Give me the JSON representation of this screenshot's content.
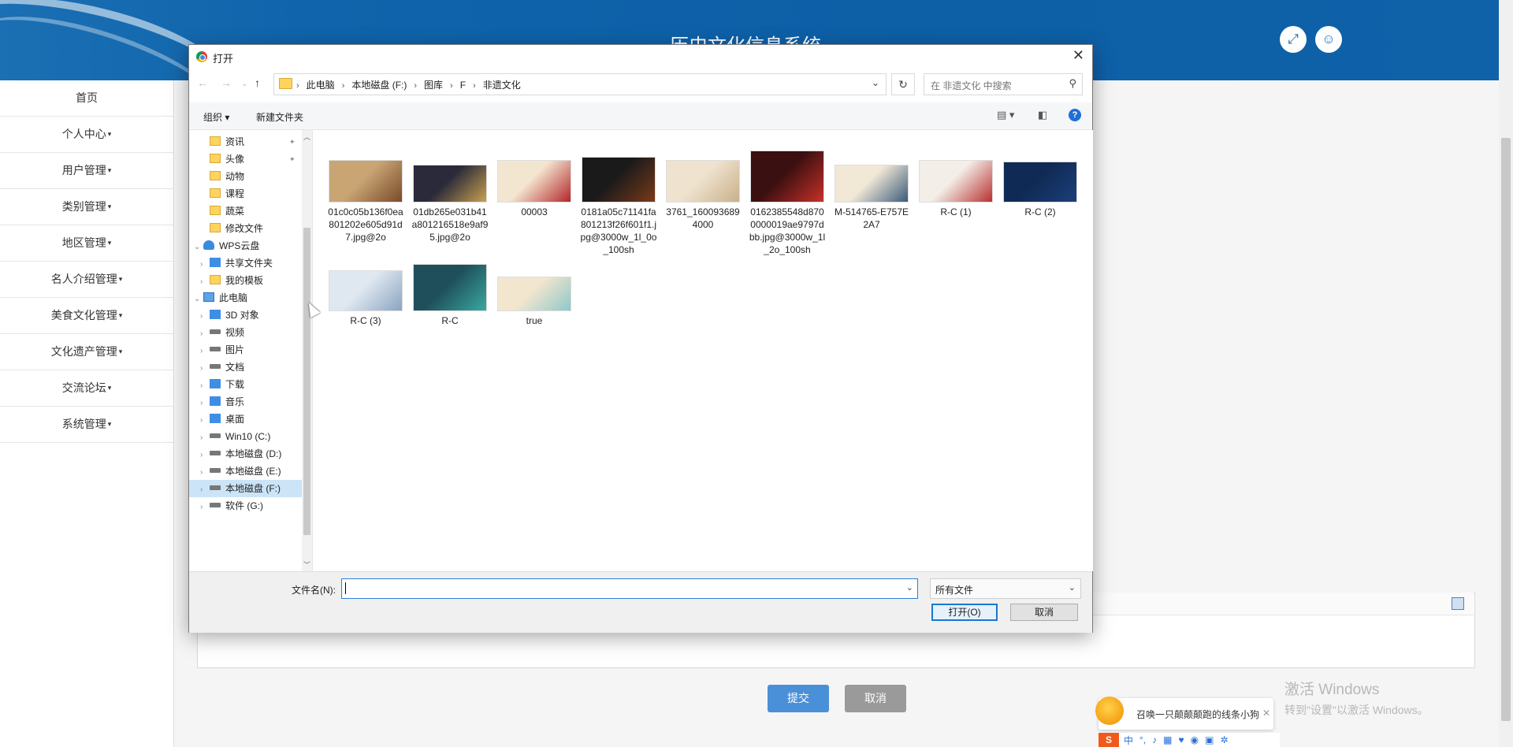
{
  "app": {
    "title": "历史文化信息系统",
    "sidebar": [
      "首页",
      "个人中心",
      "用户管理",
      "类别管理",
      "地区管理",
      "名人介绍管理",
      "美食文化管理",
      "文化遗产管理",
      "交流论坛",
      "系统管理"
    ],
    "submit_label": "提交",
    "cancel_label": "取消"
  },
  "dialog": {
    "title": "打开",
    "breadcrumb": [
      "此电脑",
      "本地磁盘 (F:)",
      "图库",
      "F",
      "非遗文化"
    ],
    "search_placeholder": "在 非遗文化 中搜索",
    "toolbar": {
      "organize": "组织 ▾",
      "new_folder": "新建文件夹"
    },
    "tree": [
      {
        "label": "资讯",
        "icon": "folder",
        "level": 1,
        "pinned": true
      },
      {
        "label": "头像",
        "icon": "folder",
        "level": 1,
        "pinned": true
      },
      {
        "label": "动物",
        "icon": "folder",
        "level": 1
      },
      {
        "label": "课程",
        "icon": "folder",
        "level": 1
      },
      {
        "label": "蔬菜",
        "icon": "folder",
        "level": 1
      },
      {
        "label": "修改文件",
        "icon": "folder",
        "level": 1
      },
      {
        "label": "WPS云盘",
        "icon": "cloud",
        "level": 0,
        "expanded": true
      },
      {
        "label": "共享文件夹",
        "icon": "blue",
        "level": 1
      },
      {
        "label": "我的模板",
        "icon": "folder",
        "level": 1
      },
      {
        "label": "此电脑",
        "icon": "pc",
        "level": 0,
        "expanded": true
      },
      {
        "label": "3D 对象",
        "icon": "blue",
        "level": 1
      },
      {
        "label": "视频",
        "icon": "drive",
        "level": 1
      },
      {
        "label": "图片",
        "icon": "drive",
        "level": 1
      },
      {
        "label": "文档",
        "icon": "drive",
        "level": 1
      },
      {
        "label": "下载",
        "icon": "blue",
        "level": 1
      },
      {
        "label": "音乐",
        "icon": "blue",
        "level": 1
      },
      {
        "label": "桌面",
        "icon": "blue",
        "level": 1
      },
      {
        "label": "Win10 (C:)",
        "icon": "drive",
        "level": 1
      },
      {
        "label": "本地磁盘 (D:)",
        "icon": "drive",
        "level": 1
      },
      {
        "label": "本地磁盘 (E:)",
        "icon": "drive",
        "level": 1
      },
      {
        "label": "本地磁盘 (F:)",
        "icon": "drive",
        "level": 1,
        "selected": true
      },
      {
        "label": "软件 (G:)",
        "icon": "drive",
        "level": 1
      }
    ],
    "files": [
      {
        "name": "01c0c05b136f0ea801202e605d91d7.jpg@2o",
        "colors": [
          "#c9a574",
          "#7a4a2a"
        ]
      },
      {
        "name": "01db265e031b41a801216518e9af95.jpg@2o",
        "colors": [
          "#2a2a3a",
          "#c9a050"
        ]
      },
      {
        "name": "00003",
        "colors": [
          "#f3e6d0",
          "#b3262a"
        ]
      },
      {
        "name": "0181a05c71141fa801213f26f601f1.jpg@3000w_1l_0o_100sh",
        "colors": [
          "#1a1a1a",
          "#7a3a1a"
        ]
      },
      {
        "name": "3761_1600936894000",
        "colors": [
          "#efe3cf",
          "#c9b08a"
        ]
      },
      {
        "name": "0162385548d8700000019ae9797dbb.jpg@3000w_1l_2o_100sh",
        "colors": [
          "#3a1010",
          "#c8302a"
        ]
      },
      {
        "name": "M-514765-E757E2A7",
        "colors": [
          "#f1e8d6",
          "#3a5a7a"
        ]
      },
      {
        "name": "R-C (1)",
        "colors": [
          "#f3efe8",
          "#b83030"
        ]
      },
      {
        "name": "R-C (2)",
        "colors": [
          "#0f2a55",
          "#1c3f7a"
        ]
      },
      {
        "name": "R-C (3)",
        "colors": [
          "#dfe8f1",
          "#8aa4c0"
        ]
      },
      {
        "name": "R-C",
        "colors": [
          "#1e4f5a",
          "#3aa8a0"
        ]
      },
      {
        "name": "true",
        "colors": [
          "#f2e6cf",
          "#8fc8c8"
        ]
      }
    ],
    "filename_label": "文件名(N):",
    "filename_value": "",
    "filetype": "所有文件",
    "open_label": "打开(O)",
    "cancel_label": "取消"
  },
  "watermark": {
    "line1": "激活 Windows",
    "line2": "转到\"设置\"以激活 Windows。"
  },
  "toast": {
    "text": "召唤一只颠颠颠跑的线条小狗"
  },
  "ime": {
    "logo": "S",
    "mode": "中"
  }
}
